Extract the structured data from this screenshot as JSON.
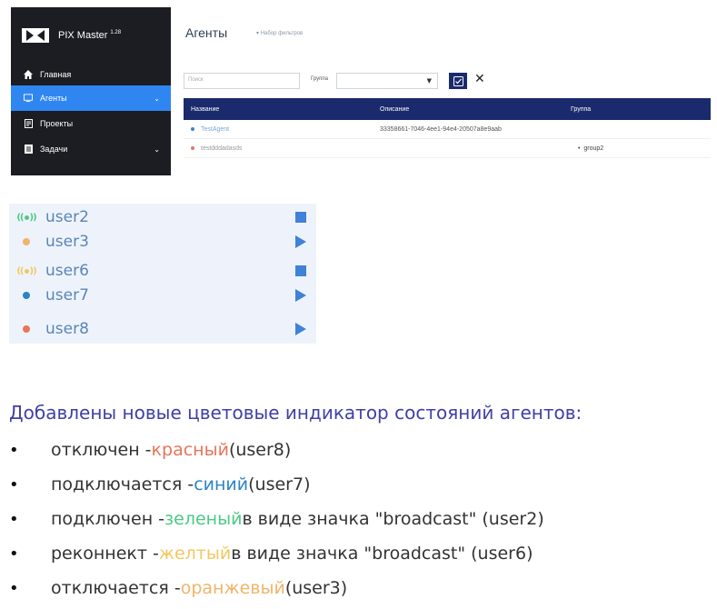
{
  "app": {
    "brand": "PIX Master",
    "version": "1.28",
    "sidebar": [
      {
        "label": "Главная",
        "icon": "home-icon"
      },
      {
        "label": "Агенты",
        "icon": "monitor-icon",
        "active": true
      },
      {
        "label": "Проекты",
        "icon": "project-icon"
      },
      {
        "label": "Задачи",
        "icon": "tasks-icon"
      }
    ],
    "page_title": "Агенты",
    "filter_set_label": "Набор фильтров",
    "search_placeholder": "Поиск",
    "group_label": "Группа",
    "group_value": "",
    "table": {
      "headers": [
        "Название",
        "Описание",
        "Группа"
      ],
      "rows": [
        {
          "name": "TestAgent",
          "description": "33358661-7046-4ee1-94e4-20507a8e9aab",
          "group": "",
          "dot_color": "#3f82d8"
        },
        {
          "name": "testdddadasds",
          "description": "",
          "group": "group2",
          "dot_color": "#e8745a"
        }
      ]
    }
  },
  "status_panel": {
    "rows": [
      {
        "user": "user2",
        "indicator": "broadcast-green",
        "color": "#4cc985",
        "action": "stop"
      },
      {
        "user": "user3",
        "indicator": "dot",
        "color": "#f0b46a",
        "action": "play"
      },
      {
        "user": "user6",
        "indicator": "broadcast-yellow",
        "color": "#f1c761",
        "action": "stop"
      },
      {
        "user": "user7",
        "indicator": "dot",
        "color": "#2c83c6",
        "action": "play"
      },
      {
        "user": "user8",
        "indicator": "dot",
        "color": "#e8745a",
        "action": "play"
      }
    ],
    "accent": "#3f82d8"
  },
  "description": {
    "title": "Добавлены новые цветовые индикатор состояний агентов:",
    "bullets": [
      {
        "pre": "отключен - ",
        "color_word": "красный",
        "mid": " (user8)",
        "cls": "c-red"
      },
      {
        "pre": "подключается - ",
        "color_word": "синий",
        "mid": " (user7)",
        "cls": "c-blue"
      },
      {
        "pre": "подключен - ",
        "color_word": "зеленый",
        "mid": " в виде значка \"broadcast\" (user2)",
        "cls": "c-green"
      },
      {
        "pre": "реконнект - ",
        "color_word": "желтый",
        "mid": " в виде значка \"broadcast\" (user6)",
        "cls": "c-yellow"
      },
      {
        "pre": "отключается - ",
        "color_word": "оранжевый",
        "mid": " (user3)",
        "cls": "c-orange"
      }
    ]
  }
}
